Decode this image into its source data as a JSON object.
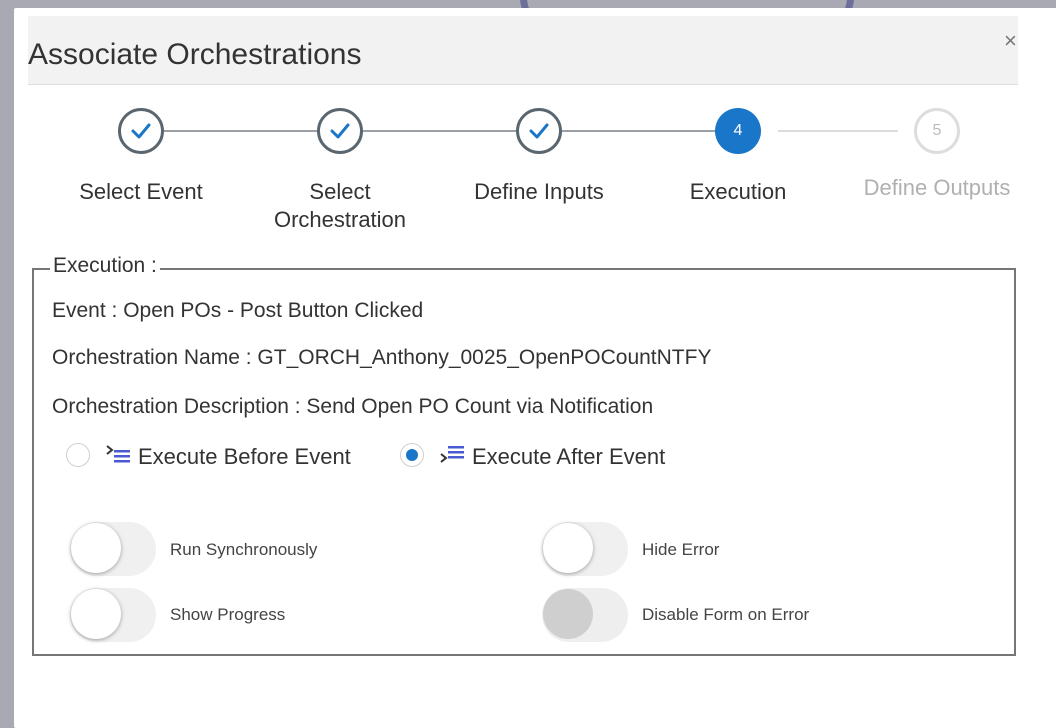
{
  "dialog": {
    "title": "Associate Orchestrations",
    "close_label": "×"
  },
  "steps": [
    {
      "label": "Select Event",
      "state": "done"
    },
    {
      "label": "Select Orchestration",
      "state": "done"
    },
    {
      "label": "Define Inputs",
      "state": "done"
    },
    {
      "label": "Execution",
      "state": "active",
      "number": "4"
    },
    {
      "label": "Define Outputs",
      "state": "pending",
      "number": "5"
    }
  ],
  "execution": {
    "legend": "Execution :",
    "event_line": "Event : Open POs - Post Button Clicked",
    "orch_name_line": "Orchestration Name : GT_ORCH_Anthony_0025_OpenPOCountNTFY",
    "orch_desc_line": "Orchestration Description : Send Open PO Count via Notification",
    "options": [
      {
        "label": "Execute Before Event",
        "selected": false
      },
      {
        "label": "Execute After Event",
        "selected": true
      }
    ],
    "toggles": [
      {
        "label": "Run Synchronously",
        "on": false,
        "enabled": true
      },
      {
        "label": "Hide Error",
        "on": false,
        "enabled": true
      },
      {
        "label": "Show Progress",
        "on": false,
        "enabled": true
      },
      {
        "label": "Disable Form on Error",
        "on": false,
        "enabled": false
      }
    ]
  },
  "colors": {
    "accent": "#1976c8",
    "check": "#1976c8",
    "backdrop": "#a9a9b3"
  },
  "icons": {
    "step_done": "checkmark-icon",
    "execute_before": "execute-before-icon",
    "execute_after": "execute-after-icon",
    "close": "close-icon"
  }
}
